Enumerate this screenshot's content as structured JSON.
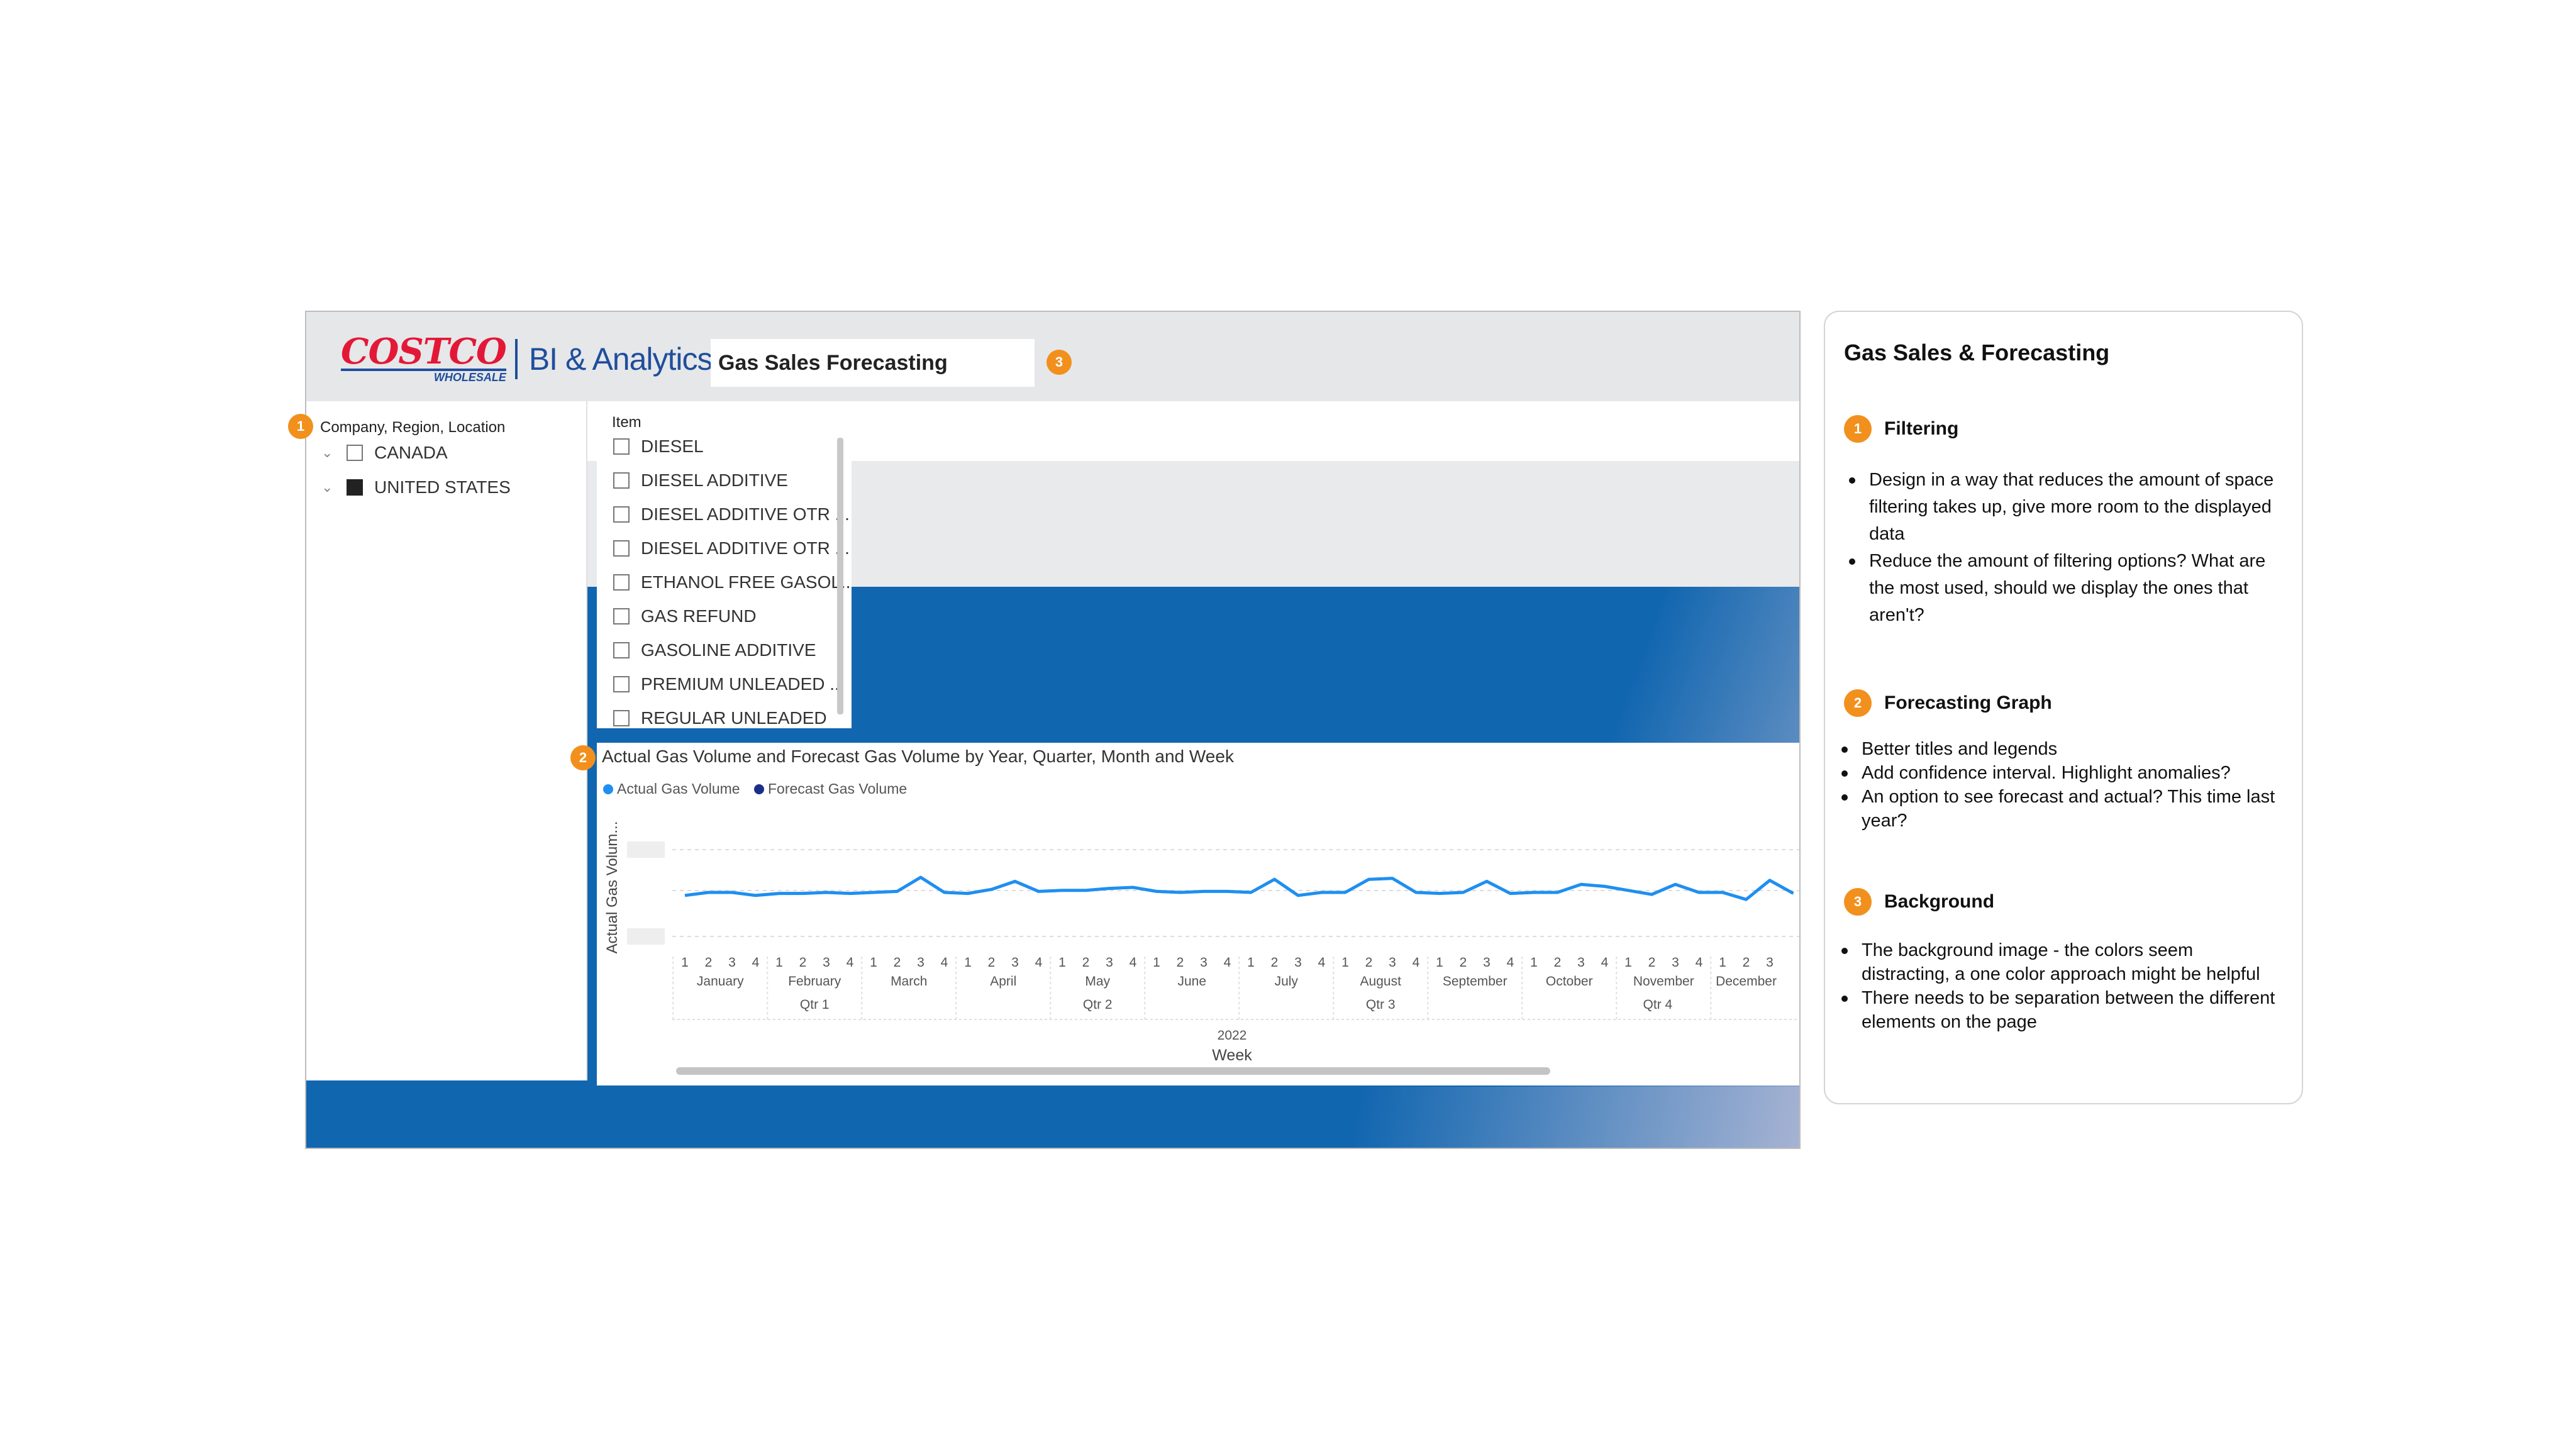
{
  "dashboard": {
    "brand": {
      "costco": "COSTCO",
      "wholesale": "WHOLESALE",
      "product": "BI & Analytics"
    },
    "title": "Gas Sales Forecasting",
    "badges": [
      "1",
      "2",
      "3"
    ],
    "location_filter": {
      "header": "Company, Region, Location",
      "items": [
        {
          "label": "CANADA",
          "checked": false
        },
        {
          "label": "UNITED STATES",
          "checked": true
        }
      ]
    },
    "item_filter": {
      "header": "Item",
      "items": [
        "DIESEL",
        "DIESEL ADDITIVE",
        "DIESEL ADDITIVE OTR ...",
        "DIESEL ADDITIVE OTR ...",
        "ETHANOL FREE GASOL...",
        "GAS REFUND",
        "GASOLINE ADDITIVE",
        "PREMIUM UNLEADED ...",
        "REGULAR UNLEADED"
      ]
    },
    "colors": {
      "accent_orange": "#f2901d",
      "background_blue": "#1166b0",
      "actual_line": "#1f8ff0",
      "forecast_dot": "#1b2f8a",
      "costco_red": "#e31837",
      "costco_blue": "#1f4e9c"
    }
  },
  "chart_data": {
    "type": "line",
    "title": "Actual Gas Volume and Forecast Gas Volume by Year, Quarter, Month and Week",
    "ylabel": "Actual Gas Volum...",
    "xlabel": "Week",
    "year": "2022",
    "quarters": [
      "Qtr 1",
      "Qtr 2",
      "Qtr 3",
      "Qtr 4"
    ],
    "months": [
      "January",
      "February",
      "March",
      "April",
      "May",
      "June",
      "July",
      "August",
      "September",
      "October",
      "November",
      "December"
    ],
    "weeks_per_month": [
      4,
      4,
      4,
      4,
      4,
      4,
      4,
      4,
      4,
      4,
      4,
      3
    ],
    "series": [
      {
        "name": "Actual Gas Volume",
        "color": "#1f8ff0",
        "values": [
          0.42,
          0.45,
          0.45,
          0.42,
          0.44,
          0.44,
          0.45,
          0.44,
          0.45,
          0.46,
          0.6,
          0.45,
          0.44,
          0.48,
          0.56,
          0.46,
          0.47,
          0.47,
          0.49,
          0.5,
          0.46,
          0.45,
          0.46,
          0.46,
          0.45,
          0.58,
          0.42,
          0.45,
          0.45,
          0.58,
          0.59,
          0.45,
          0.44,
          0.45,
          0.56,
          0.44,
          0.45,
          0.45,
          0.53,
          0.51,
          0.47,
          0.43,
          0.53,
          0.45,
          0.45,
          0.38,
          0.57,
          0.44
        ]
      },
      {
        "name": "Forecast Gas Volume",
        "color": "#1b2f8a",
        "values": []
      }
    ]
  },
  "notes": {
    "title": "Gas Sales & Forecasting",
    "sections": [
      {
        "badge": "1",
        "heading": "Filtering",
        "bullets": [
          "Design in a way that reduces the amount of space filtering takes up, give more room to the displayed data",
          "Reduce the amount of filtering options? What are the most used, should we display the ones that aren't?"
        ]
      },
      {
        "badge": "2",
        "heading": "Forecasting Graph",
        "bullets": [
          "Better titles and legends",
          "Add confidence interval. Highlight anomalies?",
          "An option to see forecast and actual? This time last year?"
        ]
      },
      {
        "badge": "3",
        "heading": "Background",
        "bullets": [
          "The background image - the colors seem distracting, a one color approach might be helpful",
          "There needs to be separation between the different elements on the page"
        ]
      }
    ]
  }
}
